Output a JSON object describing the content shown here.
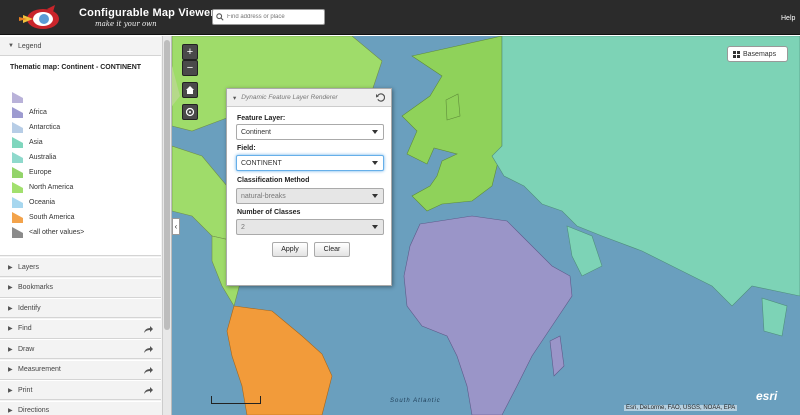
{
  "header": {
    "title": "Configurable Map Viewer",
    "subtitle": "make it your own",
    "search_placeholder": "Find address or place",
    "help": "Help"
  },
  "sidebar": {
    "legend": {
      "label": "Legend",
      "title": "Thematic map: Continent - CONTINENT",
      "items": [
        {
          "label": "",
          "color": "#b9b2d9"
        },
        {
          "label": "Africa",
          "color": "#9d9bd0"
        },
        {
          "label": "Antarctica",
          "color": "#b7cde6"
        },
        {
          "label": "Asia",
          "color": "#7fd6bd"
        },
        {
          "label": "Australia",
          "color": "#8fd9cc"
        },
        {
          "label": "Europe",
          "color": "#93d46a"
        },
        {
          "label": "North America",
          "color": "#a2e06e"
        },
        {
          "label": "Oceania",
          "color": "#a7d7ef"
        },
        {
          "label": "South America",
          "color": "#f3a34b"
        },
        {
          "label": "<all other values>",
          "color": "#8b8b8b"
        }
      ]
    },
    "panels": [
      {
        "label": "Layers",
        "share": false
      },
      {
        "label": "Bookmarks",
        "share": false
      },
      {
        "label": "Identify",
        "share": false
      },
      {
        "label": "Find",
        "share": true
      },
      {
        "label": "Draw",
        "share": true
      },
      {
        "label": "Measurement",
        "share": true
      },
      {
        "label": "Print",
        "share": true
      },
      {
        "label": "Directions",
        "share": false
      }
    ]
  },
  "map": {
    "basemaps_label": "Basemaps",
    "attribution": "Esri, DeLorme, FAO, USGS, NOAA, EPA",
    "esri_logo": "esri",
    "ocean_label": "South Atlantic",
    "colors": {
      "africa": "#9a95c8",
      "europe": "#8fd25a",
      "asia": "#7dd3b6",
      "south_america": "#f29b3a",
      "north_america": "#9fdc6a",
      "ocean": "#6a9fbe"
    }
  },
  "dfl_panel": {
    "title": "Dynamic Feature Layer Renderer",
    "feature_layer_label": "Feature Layer:",
    "feature_layer_value": "Continent",
    "field_label": "Field:",
    "field_value": "CONTINENT",
    "classification_label": "Classification Method",
    "classification_value": "natural-breaks",
    "classes_label": "Number of Classes",
    "classes_value": "2",
    "apply_label": "Apply",
    "clear_label": "Clear"
  }
}
